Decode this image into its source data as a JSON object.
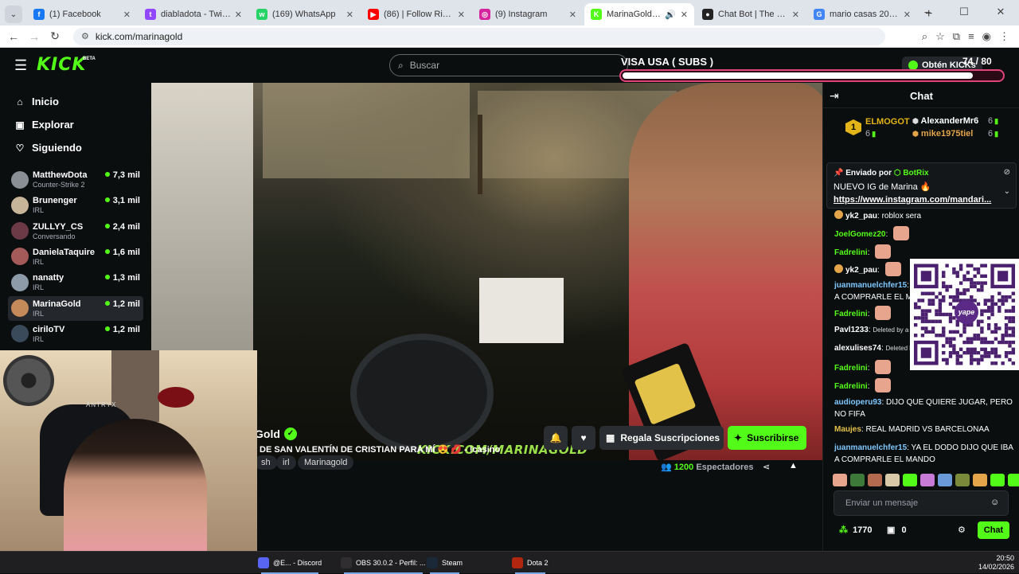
{
  "browser": {
    "tabs": [
      {
        "label": "(1) Facebook",
        "favicon_color": "#1877f2",
        "glyph": "f",
        "active": false
      },
      {
        "label": "diabladota - Twitch",
        "favicon_color": "#9146ff",
        "glyph": "t",
        "active": false
      },
      {
        "label": "(169) WhatsApp",
        "favicon_color": "#25d366",
        "glyph": "w",
        "active": false
      },
      {
        "label": "(86) | Follow Rivers - Lykk",
        "favicon_color": "#ff0000",
        "glyph": "▶",
        "active": false
      },
      {
        "label": "(9) Instagram",
        "favicon_color": "#d6249f",
        "glyph": "◎",
        "active": false
      },
      {
        "label": "MarinaGold Stream -",
        "favicon_color": "#53fc18",
        "glyph": "K",
        "active": true
      },
      {
        "label": "Chat Bot | The best ChatB",
        "favicon_color": "#222222",
        "glyph": "●",
        "active": false
      },
      {
        "label": "mario casas 2026 - Busca",
        "favicon_color": "#4285f4",
        "glyph": "G",
        "active": false
      }
    ],
    "url": "kick.com/marinagold"
  },
  "nav": {
    "search_placeholder": "Buscar",
    "obtain_kicks": "Obtén KICKs",
    "logo": "KICK",
    "beta": "BETA"
  },
  "sidebar": {
    "main": [
      {
        "label": "Inicio",
        "icon": "home-icon",
        "glyph": "⌂"
      },
      {
        "label": "Explorar",
        "icon": "compass-icon",
        "glyph": "▣"
      },
      {
        "label": "Siguiendo",
        "icon": "heart-icon",
        "glyph": "♡"
      }
    ],
    "channels": [
      {
        "name": "MatthewDota",
        "category": "Counter-Strike 2",
        "viewers": "7,3 mil",
        "color": "#8a8f96",
        "selected": false
      },
      {
        "name": "Brunenger",
        "category": "IRL",
        "viewers": "3,1 mil",
        "color": "#c7b59a",
        "selected": false
      },
      {
        "name": "ZULLYY_CS",
        "category": "Conversando",
        "viewers": "2,4 mil",
        "color": "#6b3a46",
        "selected": false
      },
      {
        "name": "DanielaTaquire",
        "category": "IRL",
        "viewers": "1,6 mil",
        "color": "#a55a5a",
        "selected": false
      },
      {
        "name": "nanatty",
        "category": "IRL",
        "viewers": "1,3 mil",
        "color": "#8d9aa8",
        "selected": false
      },
      {
        "name": "MarinaGold",
        "category": "IRL",
        "viewers": "1,2 mil",
        "color": "#c58a5a",
        "selected": true
      },
      {
        "name": "ciriloTV",
        "category": "IRL",
        "viewers": "1,2 mil",
        "color": "#3a4a5a",
        "selected": false
      }
    ]
  },
  "goal": {
    "title": "VISA USA ( SUBS )",
    "current": 74,
    "target": 80,
    "count_label": "74 / 80"
  },
  "video": {
    "watermark": "KICK.COM/MARINAGOLD",
    "webcam_chair_brand": "ANTRYX"
  },
  "stream": {
    "channel_name": "Gold",
    "title": "DE SAN VALENTÍN DE CRISTIAN PARA MÍ 😍 💋 - !casino",
    "tags": [
      "sh",
      "irl",
      "Marinagold"
    ],
    "viewers": "1200",
    "viewers_label": "Espectadores",
    "gift_label": "Regala Suscripciones",
    "subscribe_label": "Suscribirse"
  },
  "chat": {
    "title": "Chat",
    "leaderboard": [
      {
        "rank": "1",
        "name": "ELMOGOT",
        "count": "6",
        "color": "#e3b417"
      },
      {
        "name": "AlexanderMr6",
        "count": "6",
        "color": "#ffffff"
      },
      {
        "name": "mike1975tiel",
        "count": "6",
        "color": "#e3a44a"
      }
    ],
    "pinned": {
      "by_label": "Enviado por",
      "by_user": "BotRix",
      "text": "NUEVO IG de Marina 🔥",
      "link": "https://www.instagram.com/mandari..."
    },
    "messages": [
      {
        "user": "yk2_pau",
        "color": "#ffffff",
        "text": "roblox sera",
        "emote": false
      },
      {
        "user": "JoelGomez20",
        "color": "#53fc18",
        "text": "",
        "emote": true
      },
      {
        "user": "Fadrelini",
        "color": "#53fc18",
        "text": "",
        "emote": true
      },
      {
        "user": "yk2_pau",
        "color": "#ffffff",
        "text": "",
        "emote": true
      },
      {
        "user": "juanmanuelchfer15",
        "color": "#7ec8ff",
        "text": "YA EL DODO DIJO QUE IBA A COMPRARLE EL MANDO",
        "emote": false
      },
      {
        "user": "Fadrelini",
        "color": "#53fc18",
        "text": "",
        "emote": true
      },
      {
        "user": "Pavl1233",
        "color": "#ffffff",
        "text": "Deleted by a moderator",
        "emote": false
      },
      {
        "user": "alexulises74",
        "color": "#ffffff",
        "text": "Deleted by a moderator",
        "emote": false
      },
      {
        "user": "Fadrelini",
        "color": "#53fc18",
        "text": "",
        "emote": true
      },
      {
        "user": "Fadrelini",
        "color": "#53fc18",
        "text": "",
        "emote": true
      },
      {
        "user": "audioperu93",
        "color": "#7ec8ff",
        "text": "DIJO QUE QUIERE JUGAR, PERO NO FIFA",
        "emote": false
      },
      {
        "user": "Maujes",
        "color": "#e3c24a",
        "text": "REAL MADRID VS BARCELONAA",
        "emote": false
      },
      {
        "user": "juanmanuelchfer15",
        "color": "#7ec8ff",
        "text": "YA EL DODO DIJO QUE IBA A COMPRARLE EL MANDO",
        "emote": false
      }
    ],
    "qr_label": "yape",
    "input_placeholder": "Enviar un mensaje",
    "points": "1770",
    "gifts": "0",
    "send_label": "Chat"
  },
  "taskbar": {
    "items": [
      {
        "label": "@E... - Discord",
        "color": "#5865f2"
      },
      {
        "label": "OBS 30.0.2 - Perfil: ...",
        "color": "#302e31"
      },
      {
        "label": "Steam",
        "color": "#1b2838"
      },
      {
        "label": "Dota 2",
        "color": "#b1260e"
      }
    ],
    "time": "20:50",
    "date": "14/02/2026"
  }
}
